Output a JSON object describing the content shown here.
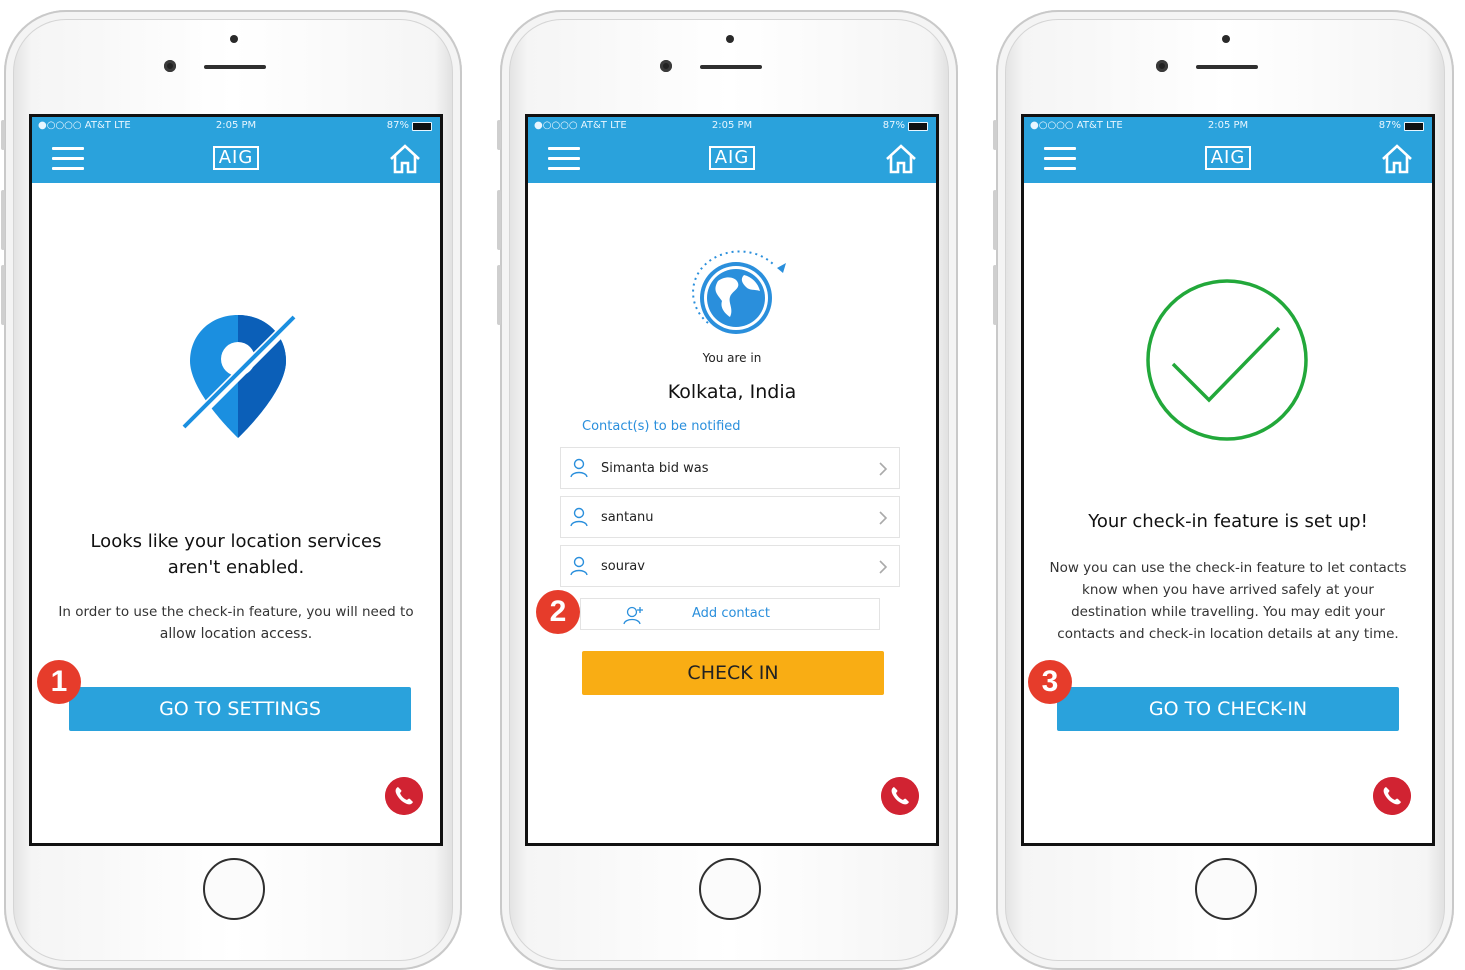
{
  "common": {
    "carrier": "●○○○○ AT&T  LTE",
    "time": "2:05 PM",
    "battery": "87%",
    "logo": "AIG",
    "icons": [
      "menu-icon",
      "home-icon",
      "phone-icon"
    ],
    "colors": {
      "brand_blue": "#2aa2dc",
      "checkin_yellow": "#f9ad14",
      "success_green": "#22a83a",
      "call_red": "#d12332",
      "badge_red": "#e63c2b"
    }
  },
  "screens": [
    {
      "step": "1",
      "title_line1": "Looks like your location services",
      "title_line2": "aren't enabled.",
      "desc_line1": "In order to use the check-in feature, you will need to",
      "desc_line2": "allow location access.",
      "button": "GO TO SETTINGS"
    },
    {
      "step": "2",
      "you_are_in": "You are in",
      "location": "Kolkata, India",
      "contacts_header": "Contact(s) to be notified",
      "contacts": [
        {
          "name": "Simanta bid was"
        },
        {
          "name": "santanu"
        },
        {
          "name": "sourav"
        }
      ],
      "add_contact": "Add contact",
      "button": "CHECK IN"
    },
    {
      "step": "3",
      "title": "Your check-in feature is set up!",
      "desc_line1": "Now you can use the check-in feature to let contacts",
      "desc_line2": "know when you have arrived safely at your",
      "desc_line3": "destination while travelling. You may edit your",
      "desc_line4": "contacts and check-in location details at any time.",
      "button": "GO TO CHECK-IN"
    }
  ]
}
